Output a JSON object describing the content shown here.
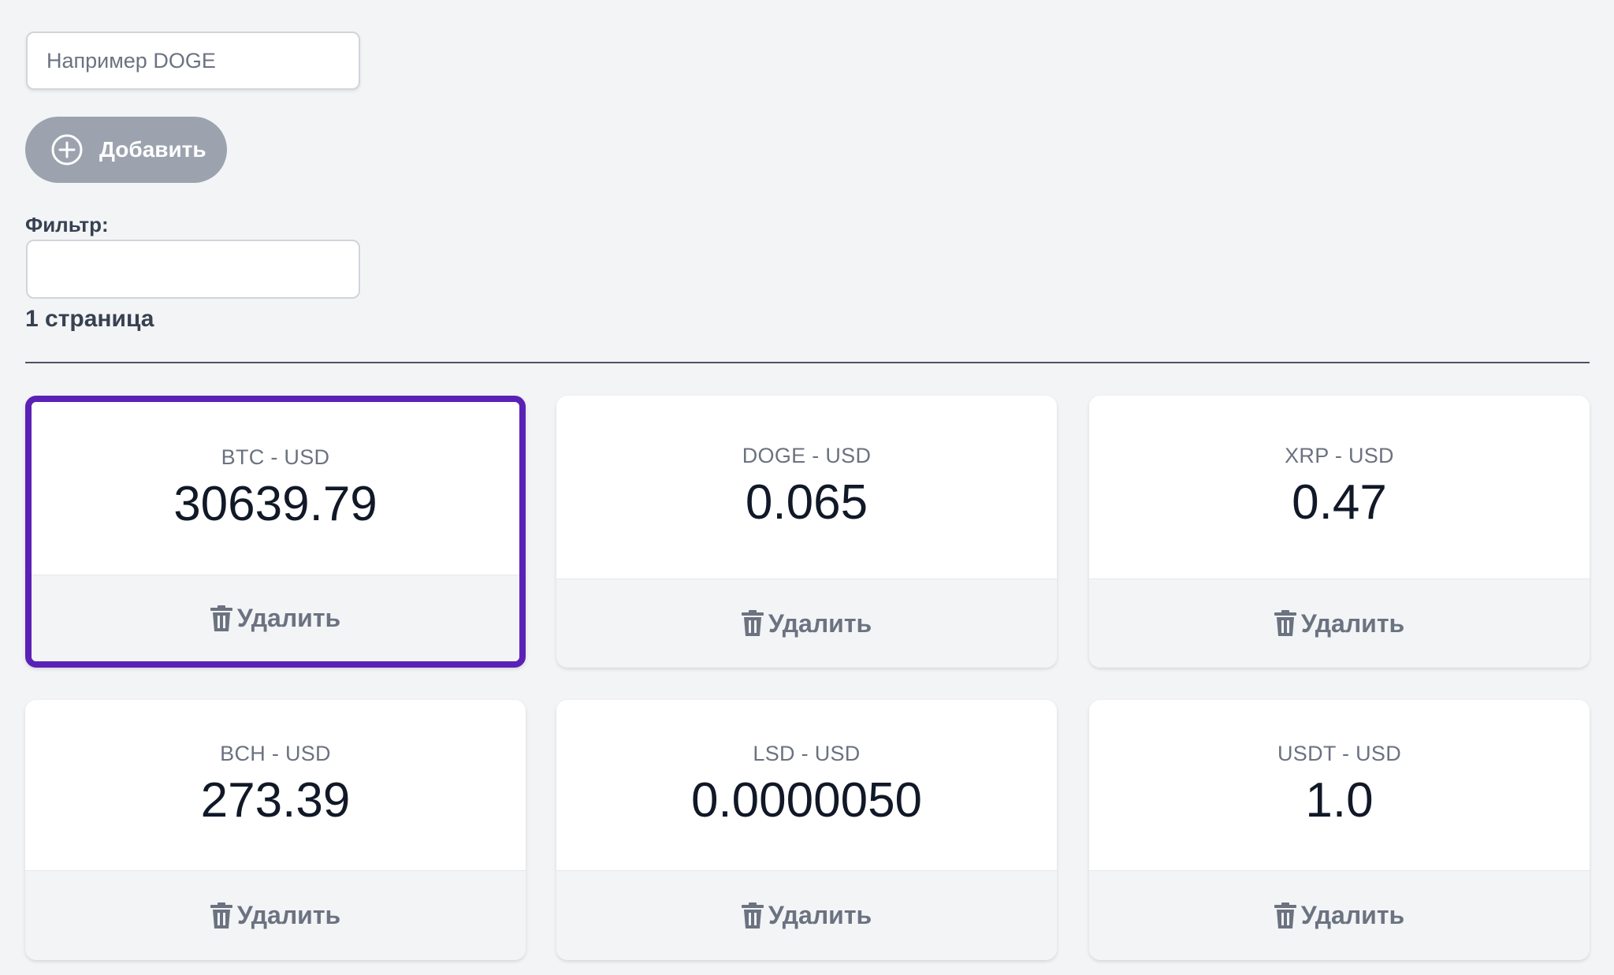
{
  "add_form": {
    "ticker_placeholder": "Например DOGE",
    "ticker_value": "",
    "add_button_label": "Добавить"
  },
  "filter": {
    "label": "Фильтр:",
    "value": "",
    "page_text": "1 страница"
  },
  "tickers": [
    {
      "pair": "BTC - USD",
      "price": "30639.79",
      "delete_label": "Удалить",
      "selected": true
    },
    {
      "pair": "DOGE - USD",
      "price": "0.065",
      "delete_label": "Удалить",
      "selected": false
    },
    {
      "pair": "XRP - USD",
      "price": "0.47",
      "delete_label": "Удалить",
      "selected": false
    },
    {
      "pair": "BCH - USD",
      "price": "273.39",
      "delete_label": "Удалить",
      "selected": false
    },
    {
      "pair": "LSD - USD",
      "price": "0.0000050",
      "delete_label": "Удалить",
      "selected": false
    },
    {
      "pair": "USDT - USD",
      "price": "1.0",
      "delete_label": "Удалить",
      "selected": false
    }
  ],
  "colors": {
    "selected_border": "#5b21b6",
    "add_button_bg": "#9ca3af",
    "page_bg": "#f3f4f6"
  },
  "icons": {
    "add": "plus-circle-icon",
    "delete": "trash-icon"
  }
}
